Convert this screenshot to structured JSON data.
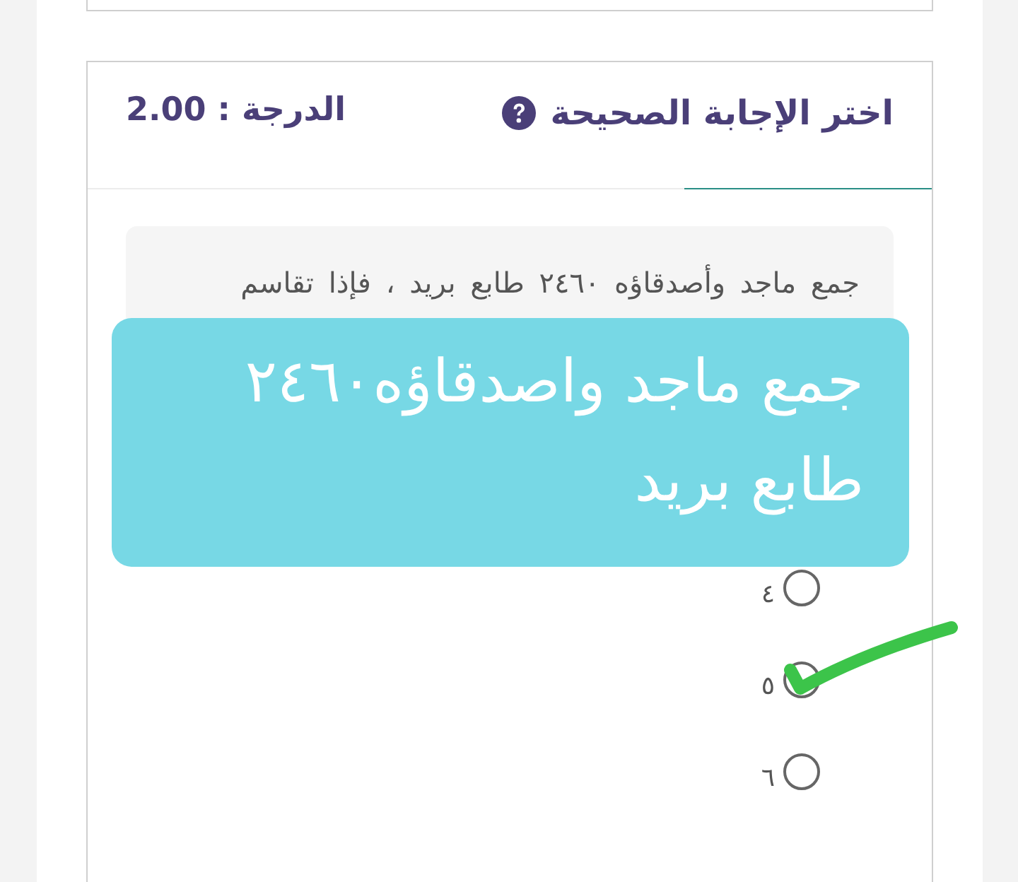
{
  "question_header": {
    "title": "اختر الإجابة الصحيحة",
    "grade": "الدرجة : 2.00"
  },
  "question": {
    "text": "جمع ماجد وأصدقاؤه ٢٤٦٠ طابع بريد ، فإذا تقاسم"
  },
  "caption_overlay": {
    "lines": [
      "جمع ماجد واصدقاؤه٢٤٦٠",
      "طابع بريد"
    ]
  },
  "options": [
    {
      "label": "٤",
      "selected": false
    },
    {
      "label": "٥",
      "selected": true
    },
    {
      "label": "٦",
      "selected": false
    }
  ]
}
